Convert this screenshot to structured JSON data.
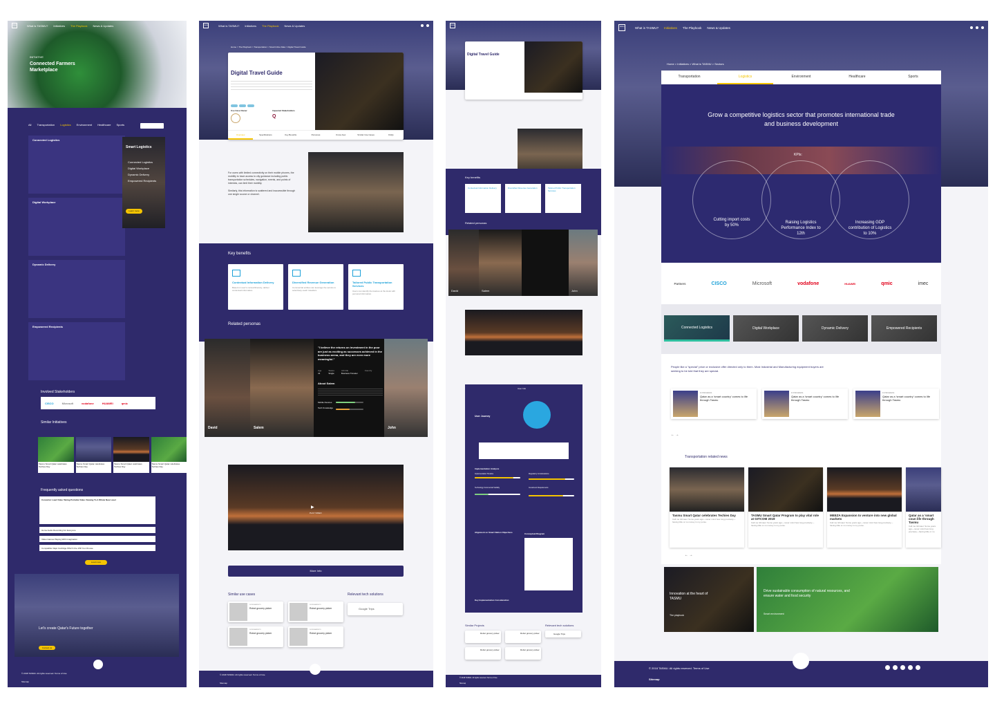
{
  "nav": {
    "logo": "TASMU",
    "links": [
      "What is TASMU?",
      "Initiatives",
      "The Playbook",
      "News & Updates"
    ]
  },
  "p1": {
    "hero_label": "INITIATIVE",
    "hero_title": "Connected Farmers Marketplace",
    "filters": [
      "All",
      "Transportation",
      "Logistics",
      "Environment",
      "Healthcare",
      "Sports"
    ],
    "groups": [
      "Connected Logistics",
      "Digital Workplace",
      "Dynamic Delivery",
      "Empowered Recipients"
    ],
    "tile_text": "Qatar as a 'smart country' comes to life through Tasmu",
    "side_title": "Smart Logistics",
    "side_items": [
      "Connected Logistics",
      "Digital Workplace",
      "Dynamic Delivery",
      "Empowered Recipients"
    ],
    "side_button": "Learn more",
    "stakeholders_title": "Involved Stakeholders",
    "similar_title": "Similar Initiatives",
    "similar_caption": "Tasmu Smart Qatar celebrates Techies Day",
    "faq_title": "Frequently asked questions",
    "faq_items": [
      "Converter Load Video Taking Portable Video Viewing To A Whole New Level",
      "Home Audio Recording For Everyone",
      "Video Games Playing With Imagination",
      "Compatible Inkjet Cartridge Which One Will You Choose"
    ],
    "faq_more": "Load more",
    "cta_title": "Let's create Qatar's Future together",
    "cta_button": "Contact us",
    "footer": "© 2018 TASMU. All rights reserved.   Terms of Use",
    "sitemap": "Sitemap"
  },
  "p2": {
    "breadcrumb": "Home > The Playbook > Transportation > Smart Inline Data > Digital Travel Guide",
    "title": "Digital Travel Guide",
    "owner_label": "Use Case Owner",
    "stakeholders_label": "Impacted Stakeholders",
    "tabs": [
      "Overview",
      "Specifications",
      "Key Benefits",
      "Personas",
      "Know-how",
      "Similar Use Cases",
      "FAQs"
    ],
    "intro": "For users with limited connectivity on their mobile phones, the mobility to have access to city guidance including public transportation schedules, navigation, events, and points of interests, can limit their mobility.",
    "intro2": "Similarly, this information is scattered and inaccessible through one single source or channel.",
    "benefits_title": "Key benefits",
    "benefits": [
      {
        "h": "Contextual Information Delivery",
        "d": "Based on user's context/itinerary, deliver contextual information."
      },
      {
        "h": "Diversified Revenue Generation",
        "d": "Commercial entities can leverage the service to selectively reach travellers."
      },
      {
        "h": "Tailored Public Transportation Services",
        "d": "Users can identify themselves at the kiosk with personal information."
      }
    ],
    "personas_title": "Related personas",
    "personas": [
      "David",
      "Salem",
      "John"
    ],
    "quote": "\"I believe the returns on investment in the poor are just as exciting as successes achieved in the business arena, and they are even more meaningful.\"",
    "stat_labels": [
      "Age",
      "Status",
      "Job title",
      "Country"
    ],
    "stat_values": [
      "41",
      "Single",
      "Business Traveler",
      ""
    ],
    "about_title": "About Salem",
    "skill_labels": [
      "Mobile Devices",
      "Tech Knowledge"
    ],
    "skill_values": [
      0.7,
      0.5
    ],
    "play_label": "PLAY VIDEO",
    "more_button": "More Info",
    "similar_title": "Similar use cases",
    "tech_title": "Relevant tech solutions",
    "use_case_label": "Robot grocery picker",
    "use_case_tag": "SUPERMARKETS",
    "tech_item": "Google Trips",
    "footer": "© 2018 TASMU. All rights reserved.   Terms of Use",
    "sitemap": "Sitemap"
  },
  "p3": {
    "title": "Digital Travel Guide",
    "benefits_title": "Key benefits",
    "benefits": [
      "Contextual Information Delivery",
      "Diversified Revenue Generation",
      "Tailored Public Transportation Services"
    ],
    "personas_title": "Related personas",
    "personas": [
      "David",
      "Salem",
      "John"
    ],
    "journey_tab": "User Info",
    "journey_title": "User Journey",
    "analysis_title": "Implementation Analysis",
    "analysis_labels": [
      "Implementation Timeline",
      "Regulatory Considerations",
      "Technology Commercial Viability",
      "Investment Requirements"
    ],
    "analysis_values": [
      0.85,
      0.8,
      0.3,
      0.75
    ],
    "alignment_title": "Alignment on Smart Nation Objectives",
    "diagram_title": "Conceptual Diagram",
    "consider_title": "Key Implementation Consideration",
    "similar_title": "Similar Projects",
    "tech_title": "Relevant tech solutions",
    "robot_label": "Robot grocery picker",
    "tech_item": "Google Trips",
    "footer": "© 2018 TASMU. All rights reserved.   Terms of Use",
    "sitemap": "Sitemap"
  },
  "p4": {
    "breadcrumb": "Home > Initiatives > What is TASMU > Sectors",
    "tabs": [
      "Transportation",
      "Logistics",
      "Environment",
      "Healthcare",
      "Sports"
    ],
    "headline": "Grow a competitive logistics sector that promotes international trade and business development",
    "kpis_label": "KPIs:",
    "kpis": [
      "Cutting import costs by 50%",
      "Raising Logistics Performance Index to 12th",
      "Increasing GDP contribution of Logistics to 10%"
    ],
    "partners_label": "Partners",
    "partners": [
      "CISCO",
      "Microsoft",
      "vodafone",
      "HUAWEI",
      "qmic",
      "imec"
    ],
    "sectors": [
      "Connected Logistics",
      "Digital Workplace",
      "Dynamic Delivery",
      "Empowered Recipients"
    ],
    "sector_desc": "People like a \"special\" price or exclusive offer directed only to them. Most Industrial and Manufacturing equipment buyers are seeking to be told that they are special.",
    "mini_tag": "IN PROGRESS",
    "mini_text": "Qatar as a 'smart country' comes to life through Tasmu",
    "news_title": "Transportation related news",
    "news": [
      {
        "h": "Tasmu Smart Qatar celebrates Techies Day",
        "d": "Call me Ishmael. Some years ago—never mind how long precisely—having little or no money in my purse."
      },
      {
        "h": "TASMU Smart Qatar Program to play vital role at GITCOM 2019",
        "d": "Call me Ishmael. Some years ago—never mind how long precisely—having little or no money in my purse."
      },
      {
        "h": "MEEZA Expansion to venture into new global markets",
        "d": "Call me Ishmael. Some years ago—never mind how long precisely—having little or no money in my purse."
      },
      {
        "h": "Qatar as a 'smart coun life through Tasmu",
        "d": "Call me Ishmael. Some years ago—never mind how long precisely—having little or no"
      }
    ],
    "promo1_title": "Innovation at the heart of TASMU",
    "promo1_link": "The playbook",
    "promo2_title": "Drive sustainable consumption of natural resources, and ensure water and food security",
    "promo2_link": "Smart environment",
    "footer": "© 2018 TASMU. All rights reserved.   Terms of Use",
    "sitemap": "Sitemap"
  }
}
